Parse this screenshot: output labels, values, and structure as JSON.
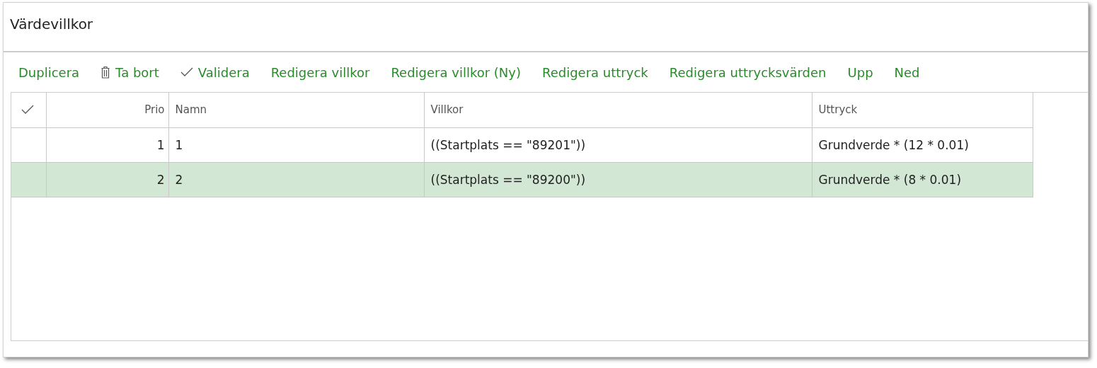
{
  "panel": {
    "title": "Värdevillkor"
  },
  "toolbar": [
    {
      "label": "Duplicera",
      "kind": "plain"
    },
    {
      "label": "Ta bort",
      "kind": "delete"
    },
    {
      "label": "Validera",
      "kind": "validate"
    },
    {
      "label": "Redigera villkor",
      "kind": "plain"
    },
    {
      "label": "Redigera villkor (Ny)",
      "kind": "plain"
    },
    {
      "label": "Redigera uttryck",
      "kind": "plain"
    },
    {
      "label": "Redigera uttrycksvärden",
      "kind": "plain"
    },
    {
      "label": "Upp",
      "kind": "plain"
    },
    {
      "label": "Ned",
      "kind": "plain"
    }
  ],
  "table": {
    "columns": [
      {
        "label": "Prio"
      },
      {
        "label": "Namn"
      },
      {
        "label": "Villkor"
      },
      {
        "label": "Uttryck"
      }
    ],
    "rows": [
      {
        "selected": false,
        "cells": [
          "1",
          "1",
          "((Startplats == \"89201\"))",
          "Grundverde * (12 * 0.01)"
        ]
      },
      {
        "selected": true,
        "cells": [
          "2",
          "2",
          "((Startplats == \"89200\"))",
          "Grundverde * (8 * 0.01)"
        ]
      }
    ]
  }
}
